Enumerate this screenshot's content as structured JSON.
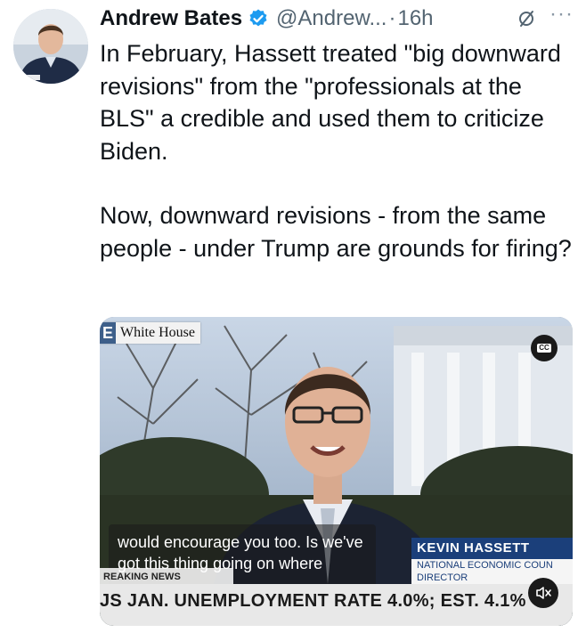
{
  "author": {
    "name": "Andrew Bates",
    "handle": "@Andrew...",
    "separator": "·",
    "time": "16h",
    "more": "···"
  },
  "tweet": {
    "paragraph_1": "In February, Hassett treated \"big downward revisions\" from the \"professionals at the BLS\" a credible and used them to criticize Biden.",
    "paragraph_2": "Now, downward revisions - from the same people - under Trump are grounds for firing?"
  },
  "video": {
    "location_tag_letter": "E",
    "location_tag": "White House",
    "cc_label": "CC",
    "caption": "would encourage you too. Is we've got this thing going on where",
    "breaking_label": "REAKING NEWS",
    "lower_third_name": "KEVIN HASSETT",
    "lower_third_title_1": "NATIONAL ECONOMIC COUN",
    "lower_third_title_2": "DIRECTOR",
    "ticker": "JS JAN. UNEMPLOYMENT RATE 4.0%; EST. 4.1%"
  },
  "colors": {
    "verified_blue": "#1d9bf0",
    "secondary_text": "#536471",
    "lower_third_blue": "#1b3f7a"
  },
  "icons": {
    "verified": "verified-badge-icon",
    "grok": "grok-icon",
    "cc": "closed-captions-icon",
    "mute": "muted-speaker-icon"
  }
}
